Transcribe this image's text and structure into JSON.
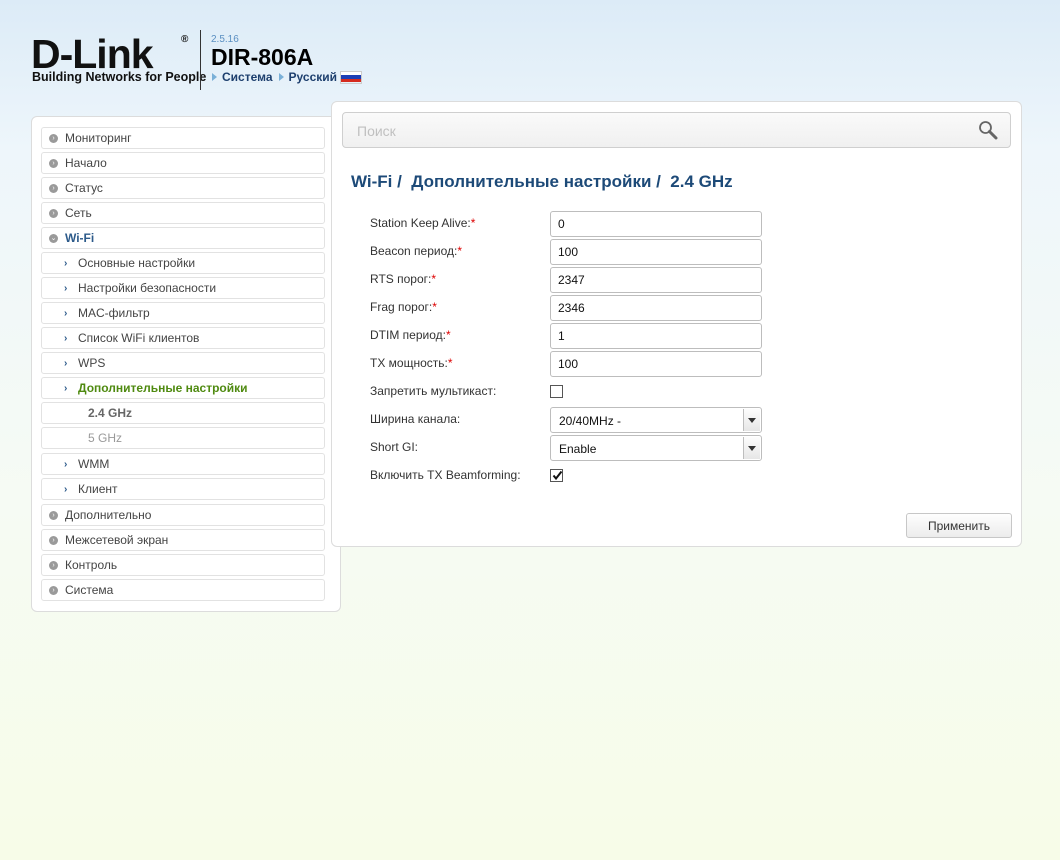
{
  "header": {
    "logo_text": "D-Link",
    "logo_reg": "®",
    "tagline": "Building Networks for People",
    "firmware": "2.5.16",
    "model": "DIR-806A",
    "links": [
      "Система",
      "Русский"
    ]
  },
  "sidebar": {
    "items": [
      {
        "label": "Мониторинг"
      },
      {
        "label": "Начало"
      },
      {
        "label": "Статус"
      },
      {
        "label": "Сеть"
      },
      {
        "label": "Wi-Fi"
      },
      {
        "label": "Основные настройки"
      },
      {
        "label": "Настройки безопасности"
      },
      {
        "label": "MAC-фильтр"
      },
      {
        "label": "Список WiFi клиентов"
      },
      {
        "label": "WPS"
      },
      {
        "label": "Дополнительные настройки"
      },
      {
        "label": "2.4 GHz"
      },
      {
        "label": "5 GHz"
      },
      {
        "label": "WMM"
      },
      {
        "label": "Клиент"
      },
      {
        "label": "Дополнительно"
      },
      {
        "label": "Межсетевой экран"
      },
      {
        "label": "Контроль"
      },
      {
        "label": "Система"
      }
    ]
  },
  "main": {
    "search_placeholder": "Поиск",
    "title": "Wi-Fi /  Дополнительные настройки /  2.4 GHz",
    "fields": {
      "keep_alive": {
        "label": "Station Keep Alive:",
        "value": "0"
      },
      "beacon": {
        "label": "Beacon период:",
        "value": "100"
      },
      "rts": {
        "label": "RTS порог:",
        "value": "2347"
      },
      "frag": {
        "label": "Frag порог:",
        "value": "2346"
      },
      "dtim": {
        "label": "DTIM период:",
        "value": "1"
      },
      "tx_power": {
        "label": "TX мощность:",
        "value": "100"
      },
      "multicast": {
        "label": "Запретить мультикаст:",
        "checked": false
      },
      "bandwidth": {
        "label": "Ширина канала:",
        "value": "20/40MHz -"
      },
      "short_gi": {
        "label": "Short GI:",
        "value": "Enable"
      },
      "beamforming": {
        "label": "Включить TX Beamforming:",
        "checked": true
      }
    },
    "required_mark": "*",
    "apply_label": "Применить"
  },
  "colors": {
    "accent": "#1d4a78",
    "active_green": "#4f8a10",
    "required": "#dd0000"
  }
}
